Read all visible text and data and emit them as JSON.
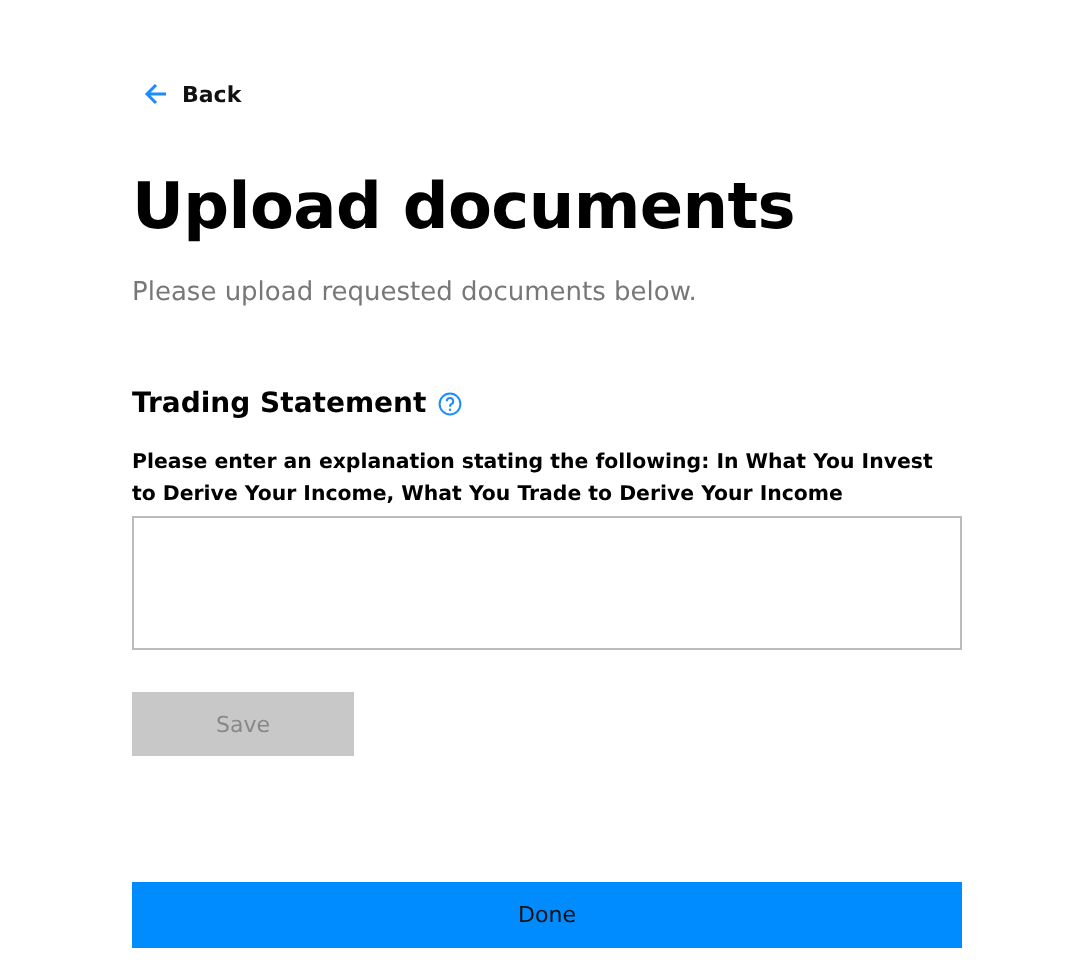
{
  "back_link": {
    "label": "Back"
  },
  "title": "Upload documents",
  "subtitle": "Please upload requested documents below.",
  "section": {
    "title": "Trading Statement",
    "field_label": "Please enter an explanation stating the following: In What You Invest to Derive Your Income, What You Trade to Derive Your Income"
  },
  "save_button": {
    "label": "Save",
    "disabled": true
  },
  "done_button": {
    "label": "Done",
    "disabled": false
  }
}
